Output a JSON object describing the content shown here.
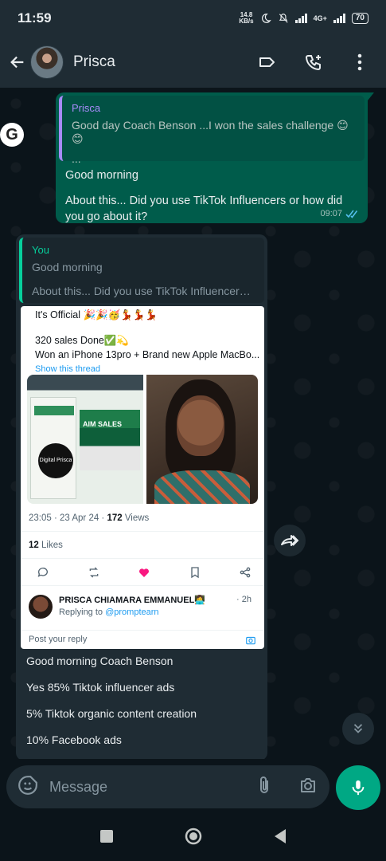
{
  "status": {
    "time": "11:59",
    "speed_top": "14.8",
    "speed_bottom": "KB/s",
    "network": "4G+",
    "battery": "70"
  },
  "header": {
    "contact_name": "Prisca"
  },
  "chat": {
    "side_badge": "G",
    "outgoing": {
      "quote_author": "Prisca",
      "quote_text": "Good day Coach Benson ...I won the sales challenge 😊😊",
      "quote_more": "...",
      "lines": [
        "Good morning",
        "About this... Did you use TikTok Influencers or how did you go about it?"
      ],
      "time": "09:07"
    },
    "incoming": {
      "quote_author": "You",
      "quote_line1": "Good morning",
      "quote_line2": "About this... Did you use TikTok Influencers or how did you go about it?",
      "tweet": {
        "line1": "It's Official 🎉🎉🥳💃💃💃",
        "line2": "320 sales Done✅💫",
        "line3": "Won an iPhone 13pro + Brand new Apple MacBo...",
        "show_thread": "Show this thread",
        "img_badge": "Digital Prisca",
        "img_aim": "AIM SALES",
        "time": "23:05 · 23 Apr 24 · ",
        "views_count": "172",
        "views_label": " Views",
        "likes_count": "12",
        "likes_label": " Likes",
        "reply_name": "PRISCA CHIAMARA EMMANUEL👩‍💻",
        "reply_time": "· 2h",
        "reply_to_label": "Replying to ",
        "reply_to_handle": "@promptearn",
        "post_reply": "Post your reply"
      },
      "lines": [
        "Good morning Coach Benson",
        "Yes 85% Tiktok influencer ads",
        "5% Tiktok organic content creation",
        "10% Facebook ads"
      ]
    }
  },
  "composer": {
    "placeholder": "Message"
  },
  "icons": {
    "back": "arrow-left-icon",
    "label": "label-icon",
    "call": "add-call-icon",
    "menu": "more-vert-icon",
    "emoji": "sticker-icon",
    "attach": "paperclip-icon",
    "camera": "camera-icon",
    "mic": "mic-icon",
    "forward": "forward-icon",
    "scroll": "double-chevron-down-icon"
  },
  "colors": {
    "outgoing_bubble": "#005c4b",
    "incoming_bubble": "#1f2c34",
    "accent": "#00a884",
    "quote_you": "#06cf9c",
    "quote_prisca": "#a78bfa"
  }
}
